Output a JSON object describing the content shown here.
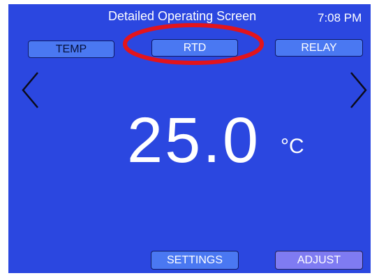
{
  "header": {
    "title": "Detailed Operating Screen",
    "time": "7:08 PM"
  },
  "tabs": {
    "temp": "TEMP",
    "rtd": "RTD",
    "relay": "RELAY"
  },
  "display": {
    "value": "25.0",
    "unit": "°C"
  },
  "footer": {
    "settings": "SETTINGS",
    "adjust": "ADJUST"
  },
  "colors": {
    "background": "#2b47e0",
    "button": "#4a78f2",
    "adjust_button": "#7f7bf2",
    "highlight": "#e3141c"
  },
  "icons": {
    "prev": "chevron-left-icon",
    "next": "chevron-right-icon"
  }
}
